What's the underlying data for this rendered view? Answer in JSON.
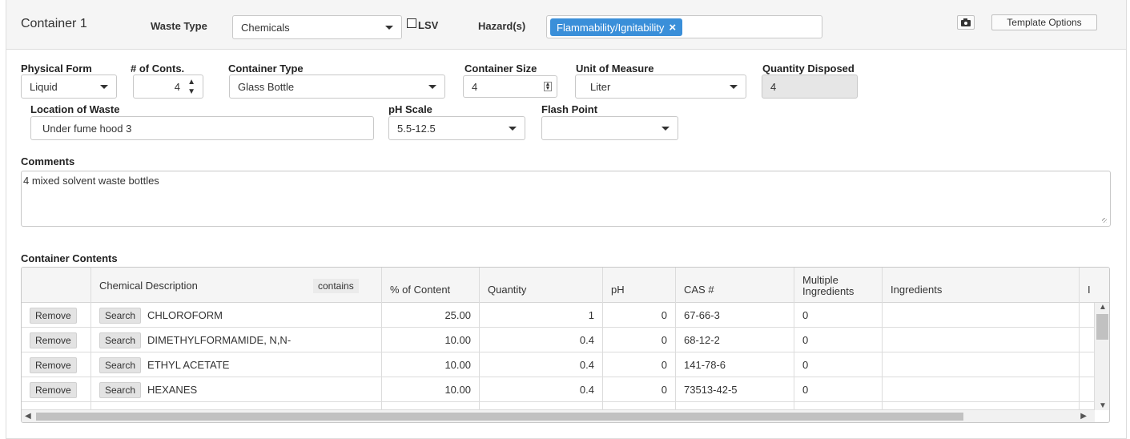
{
  "header": {
    "container_title": "Container 1",
    "waste_type_label": "Waste Type",
    "waste_type_value": "Chemicals",
    "lsv_label": "LSV",
    "hazards_label": "Hazard(s)",
    "hazard_tag": "Flammability/Ignitability",
    "template_options_label": "Template Options",
    "camera_icon": "camera-icon"
  },
  "form": {
    "physical_form_label": "Physical Form",
    "physical_form_value": "Liquid",
    "num_conts_label": "# of Conts.",
    "num_conts_value": "4",
    "container_type_label": "Container Type",
    "container_type_value": "Glass Bottle",
    "container_size_label": "Container Size",
    "container_size_value": "4",
    "unit_label": "Unit of Measure",
    "unit_value": "Liter",
    "quantity_disposed_label": "Quantity Disposed",
    "quantity_disposed_value": "4",
    "location_label": "Location of Waste",
    "location_value": "Under fume hood 3",
    "ph_label": "pH Scale",
    "ph_value": "5.5-12.5",
    "flash_point_label": "Flash Point",
    "flash_point_value": "",
    "comments_label": "Comments",
    "comments_value": "4 mixed solvent waste bottles"
  },
  "contents": {
    "section_label": "Container Contents",
    "columns": {
      "chem_desc": "Chemical Description",
      "contains": "contains",
      "pct": "% of Content",
      "quantity": "Quantity",
      "ph": "pH",
      "cas": "CAS #",
      "multiple": "Multiple Ingredients",
      "ingredients": "Ingredients",
      "cut": "I"
    },
    "remove_label": "Remove",
    "search_label": "Search",
    "rows": [
      {
        "name": "CHLOROFORM",
        "pct": "25.00",
        "qty": "1",
        "ph": "0",
        "cas": "67-66-3",
        "multi": "0"
      },
      {
        "name": "DIMETHYLFORMAMIDE, N,N-",
        "pct": "10.00",
        "qty": "0.4",
        "ph": "0",
        "cas": "68-12-2",
        "multi": "0"
      },
      {
        "name": "ETHYL ACETATE",
        "pct": "10.00",
        "qty": "0.4",
        "ph": "0",
        "cas": "141-78-6",
        "multi": "0"
      },
      {
        "name": "HEXANES",
        "pct": "10.00",
        "qty": "0.4",
        "ph": "0",
        "cas": "73513-42-5",
        "multi": "0"
      }
    ]
  }
}
